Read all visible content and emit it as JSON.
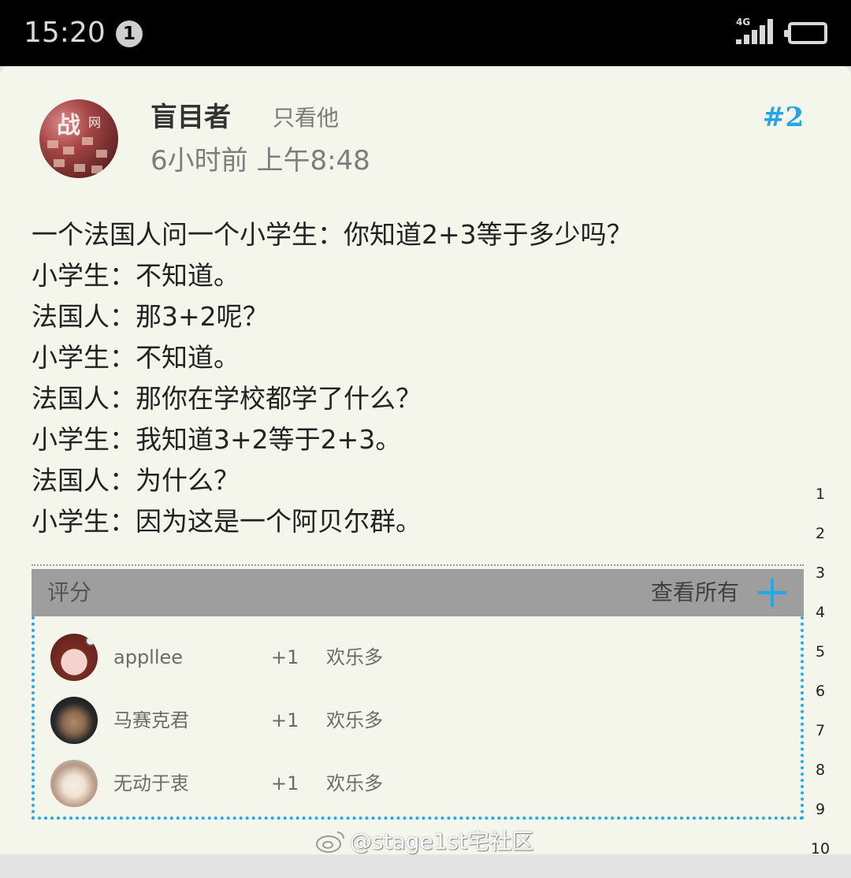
{
  "status_bar": {
    "time": "15:20",
    "notification_count": "1",
    "network": "4G"
  },
  "post": {
    "author": "盲目者",
    "only_view_label": "只看他",
    "timestamp": "6小时前 上午8:48",
    "floor": "#2",
    "lines": [
      "一个法国人问一个小学生：你知道2+3等于多少吗？",
      "小学生：不知道。",
      "法国人：那3+2呢？",
      "小学生：不知道。",
      "法国人：那你在学校都学了什么？",
      "小学生：我知道3+2等于2+3。",
      "法国人：为什么？",
      "小学生：因为这是一个阿贝尔群。"
    ]
  },
  "ratings": {
    "title": "评分",
    "view_all_label": "查看所有",
    "items": [
      {
        "user": "appllee",
        "score": "+1",
        "reason": "欢乐多"
      },
      {
        "user": "马赛克君",
        "score": "+1",
        "reason": "欢乐多"
      },
      {
        "user": "无动于衷",
        "score": "+1",
        "reason": "欢乐多"
      }
    ]
  },
  "side_index": [
    "1",
    "2",
    "3",
    "4",
    "5",
    "6",
    "7",
    "8",
    "9",
    "10"
  ],
  "watermark": "@stage1st宅社区",
  "colors": {
    "accent": "#1eaaf1",
    "floor_number": "#23a7e3",
    "card_background": "#f4f6ec",
    "ratings_header": "#9e9e9e"
  }
}
